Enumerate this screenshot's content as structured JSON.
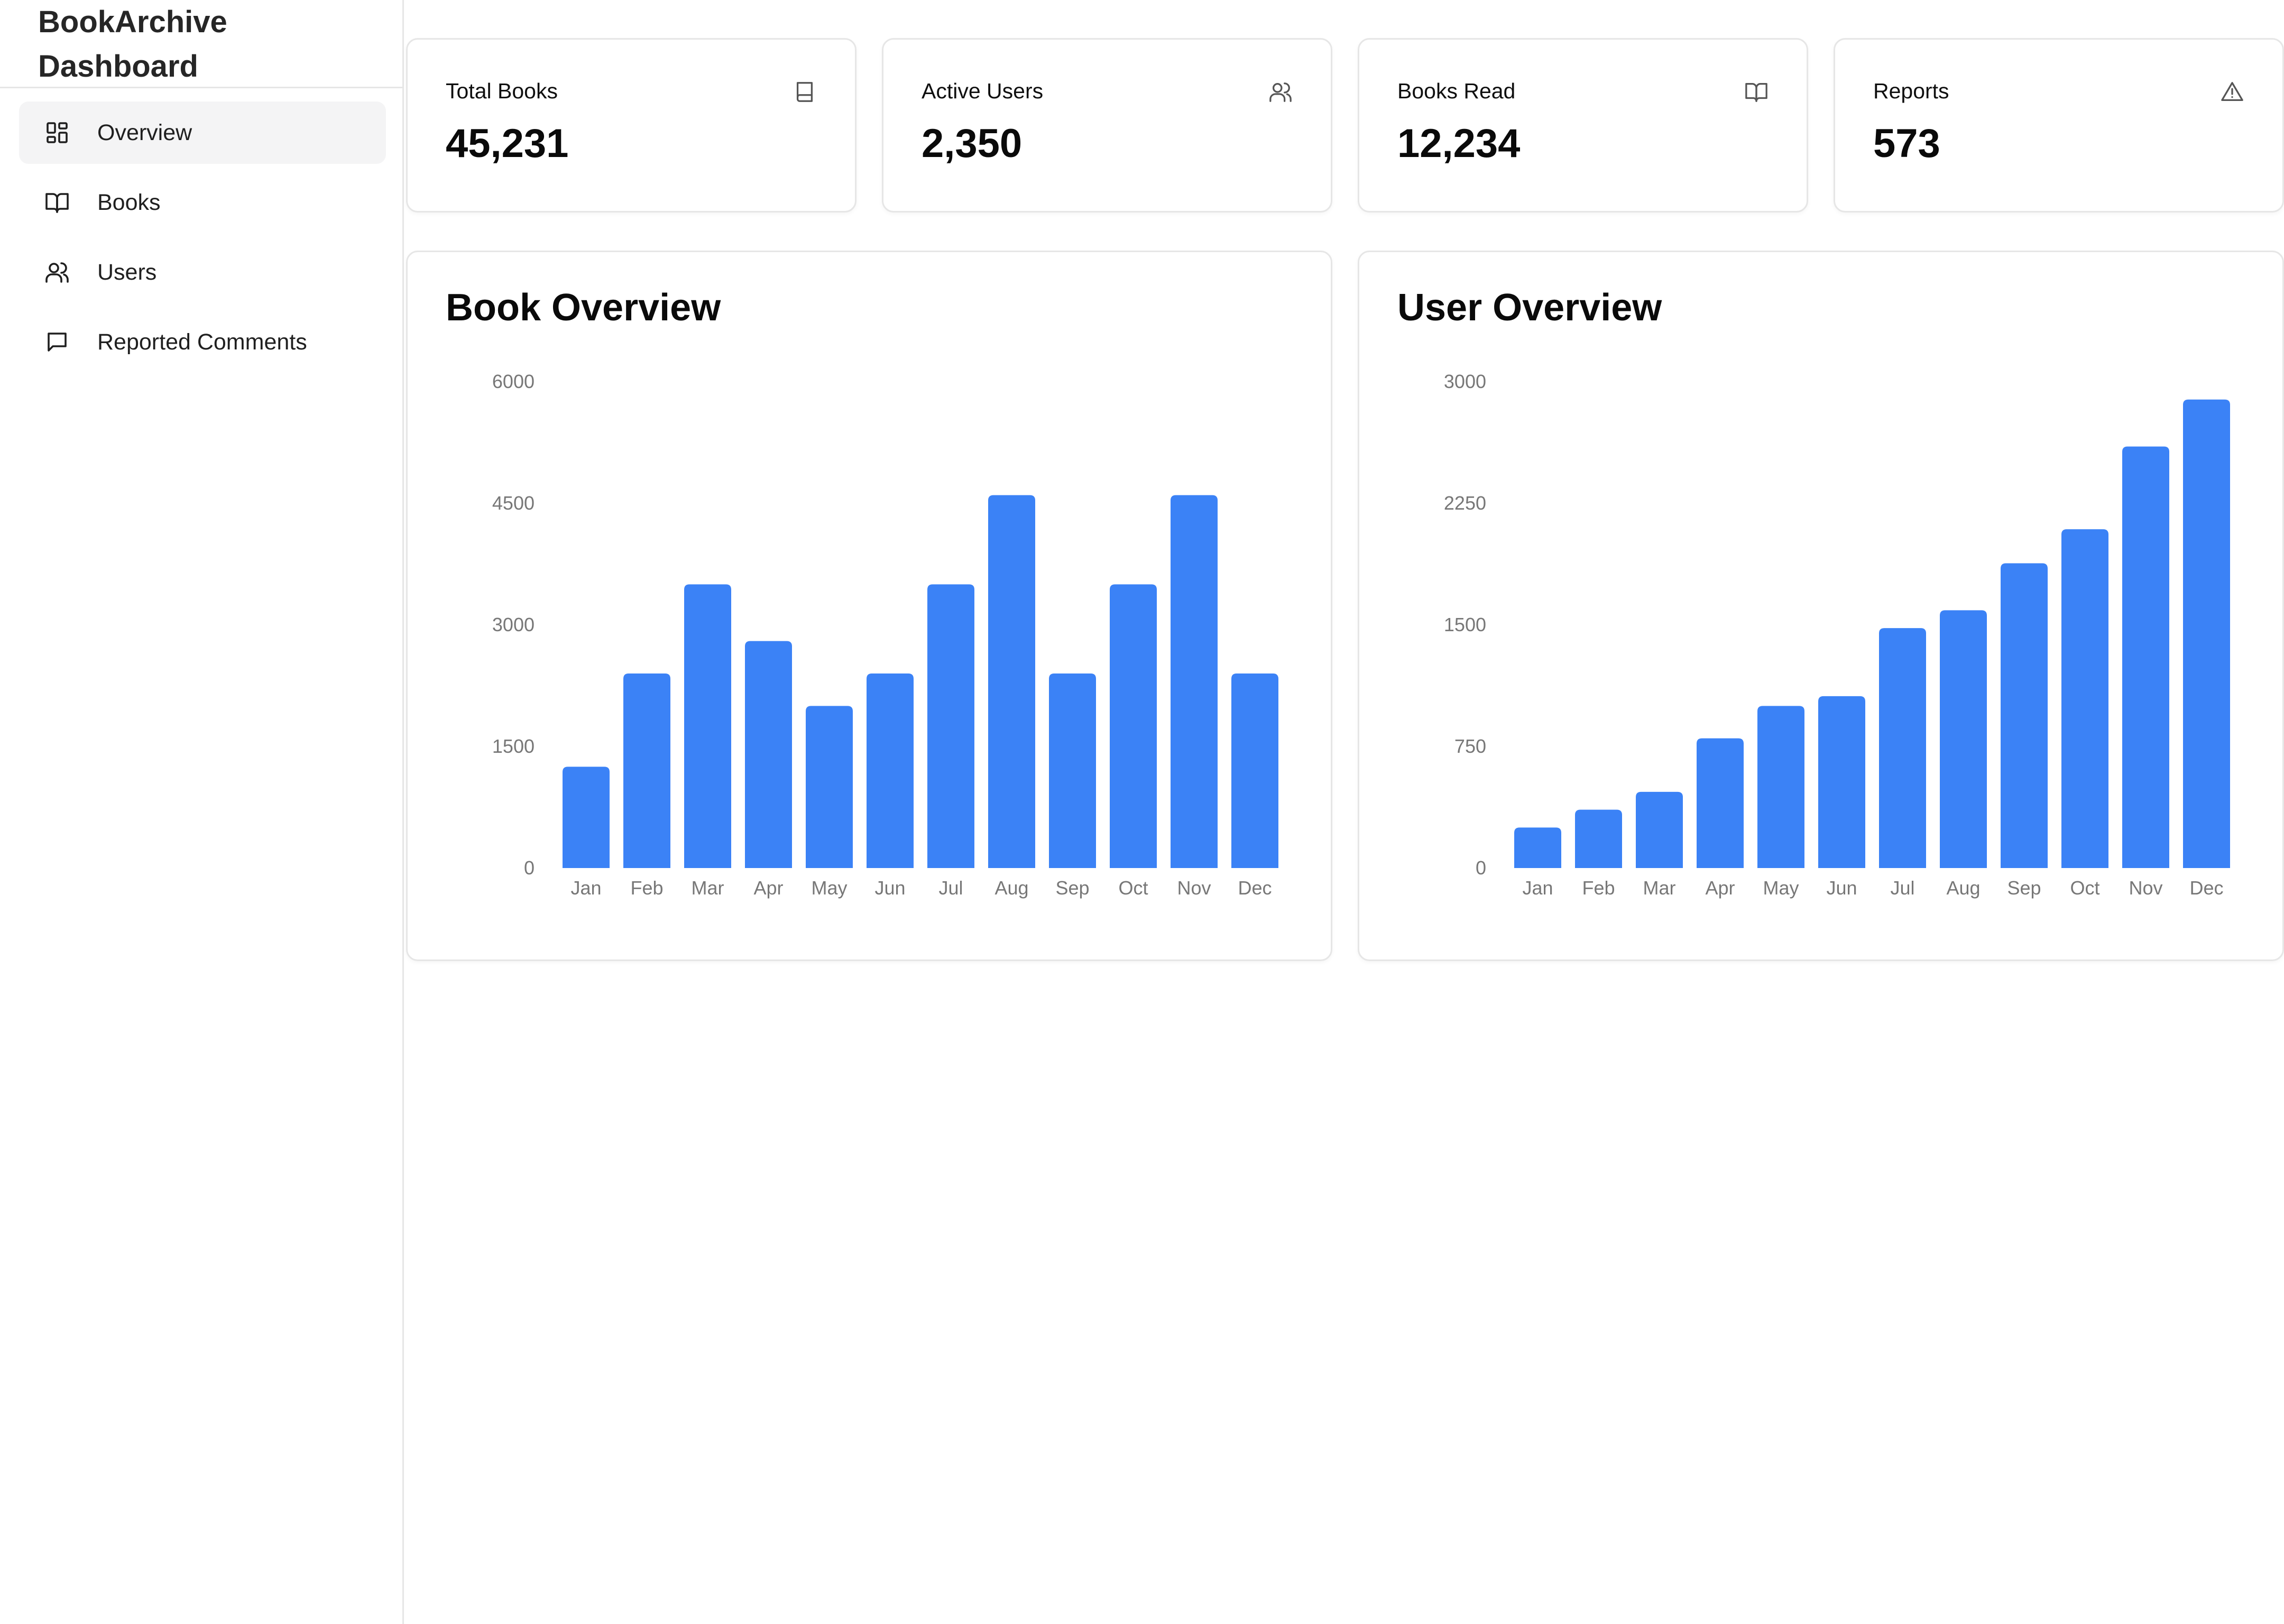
{
  "sidebar": {
    "brand": "BookArchive Dashboard",
    "items": [
      {
        "label": "Overview",
        "icon": "dashboard-icon",
        "active": true
      },
      {
        "label": "Books",
        "icon": "book-open-icon",
        "active": false
      },
      {
        "label": "Users",
        "icon": "users-icon",
        "active": false
      },
      {
        "label": "Reported Comments",
        "icon": "message-square-icon",
        "active": false
      }
    ]
  },
  "stats": [
    {
      "title": "Total Books",
      "value": "45,231",
      "icon": "book-icon"
    },
    {
      "title": "Active Users",
      "value": "2,350",
      "icon": "users-icon"
    },
    {
      "title": "Books Read",
      "value": "12,234",
      "icon": "book-open-icon"
    },
    {
      "title": "Reports",
      "value": "573",
      "icon": "alert-triangle-icon"
    }
  ],
  "colors": {
    "bar": "#3b82f6",
    "axis_text": "#777777",
    "border": "#e6e6e6",
    "active_nav": "#f4f4f5"
  },
  "chart_data": [
    {
      "type": "bar",
      "title": "Book Overview",
      "categories": [
        "Jan",
        "Feb",
        "Mar",
        "Apr",
        "May",
        "Jun",
        "Jul",
        "Aug",
        "Sep",
        "Oct",
        "Nov",
        "Dec"
      ],
      "values": [
        1250,
        2400,
        3500,
        2800,
        2000,
        2400,
        3500,
        4600,
        2400,
        3500,
        4600,
        2400
      ],
      "ylim": [
        0,
        6000
      ],
      "yticks": [
        0,
        1500,
        3000,
        4500,
        6000
      ],
      "grid": false,
      "legend": "none"
    },
    {
      "type": "bar",
      "title": "User Overview",
      "categories": [
        "Jan",
        "Feb",
        "Mar",
        "Apr",
        "May",
        "Jun",
        "Jul",
        "Aug",
        "Sep",
        "Oct",
        "Nov",
        "Dec"
      ],
      "values": [
        250,
        360,
        470,
        800,
        1000,
        1060,
        1480,
        1590,
        1880,
        2090,
        2600,
        2890
      ],
      "ylim": [
        0,
        3000
      ],
      "yticks": [
        0,
        750,
        1500,
        2250,
        3000
      ],
      "grid": false,
      "legend": "none"
    }
  ]
}
